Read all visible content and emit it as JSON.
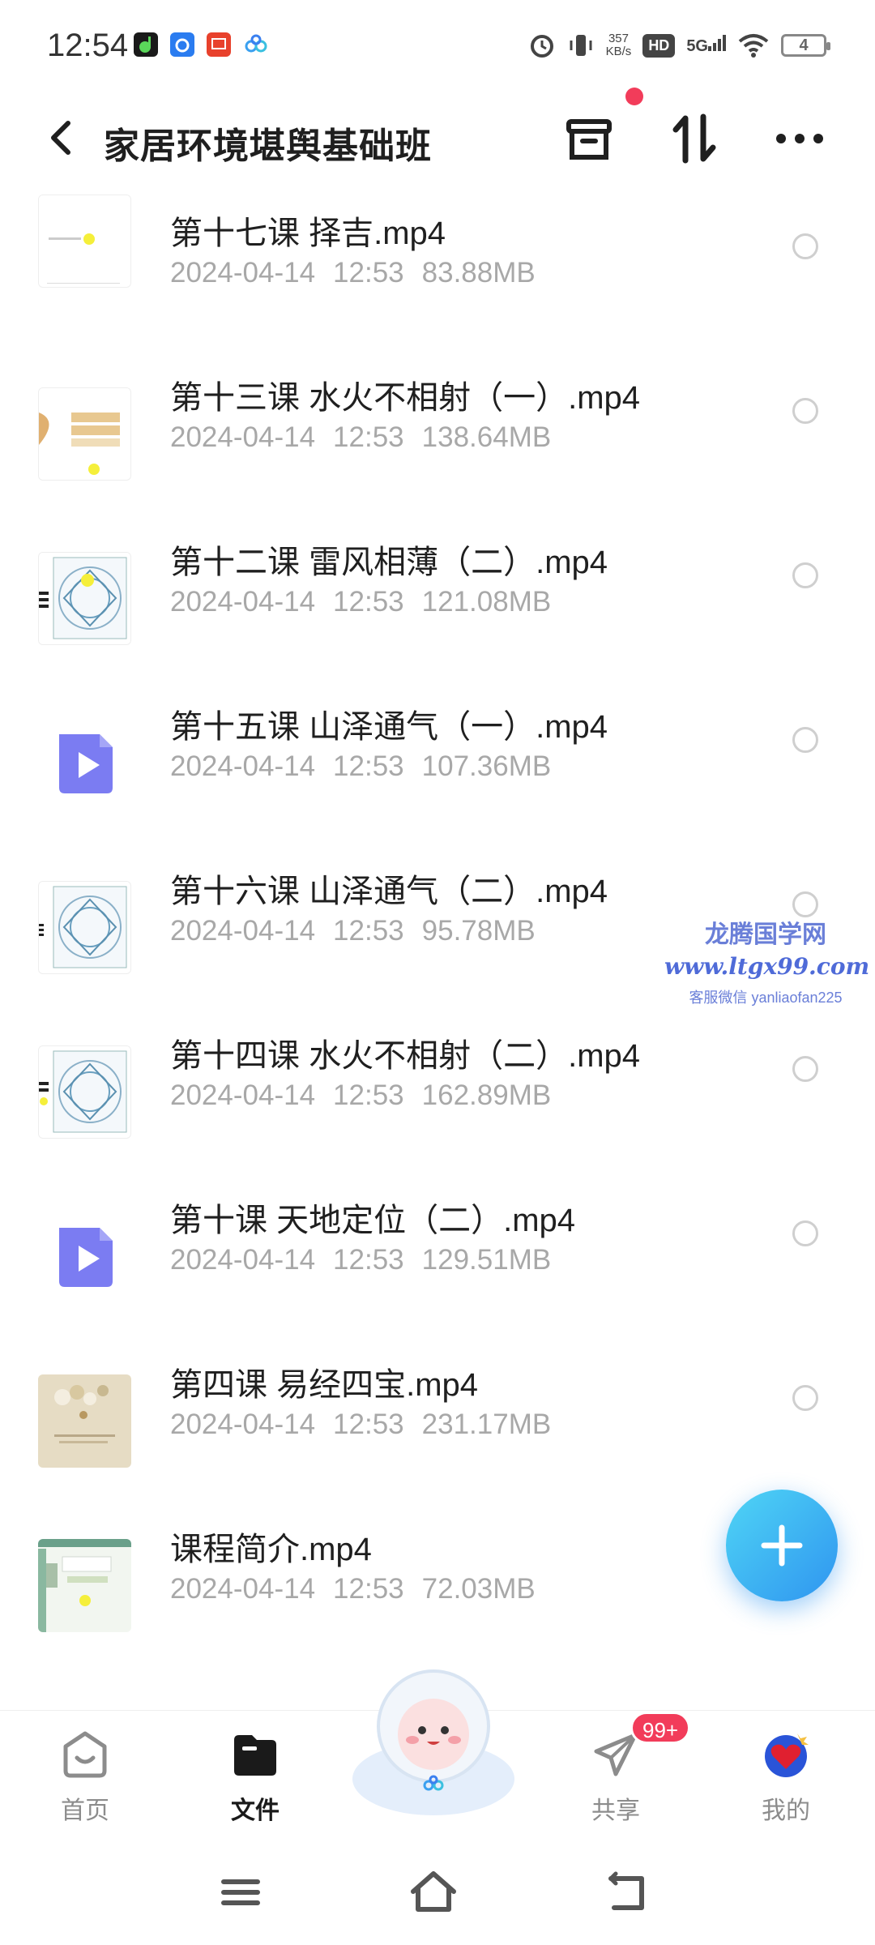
{
  "status_bar": {
    "time": "12:54",
    "net_speed_value": "357",
    "net_speed_unit": "KB/s",
    "hd": "HD",
    "signal": "5G",
    "battery": "4"
  },
  "header": {
    "title": "家居环境堪舆基础班"
  },
  "files": [
    {
      "name": "第十七课  择吉.mp4",
      "date": "2024-04-14",
      "time": "12:53",
      "size": "83.88MB",
      "thumb": "doc"
    },
    {
      "name": "第十三课 水火不相射（一）.mp4",
      "date": "2024-04-14",
      "time": "12:53",
      "size": "138.64MB",
      "thumb": "slide"
    },
    {
      "name": "第十二课 雷风相薄（二）.mp4",
      "date": "2024-04-14",
      "time": "12:53",
      "size": "121.08MB",
      "thumb": "diagram"
    },
    {
      "name": "第十五课 山泽通气（一）.mp4",
      "date": "2024-04-14",
      "time": "12:53",
      "size": "107.36MB",
      "thumb": "video"
    },
    {
      "name": "第十六课 山泽通气（二）.mp4",
      "date": "2024-04-14",
      "time": "12:53",
      "size": "95.78MB",
      "thumb": "diagram"
    },
    {
      "name": "第十四课 水火不相射（二）.mp4",
      "date": "2024-04-14",
      "time": "12:53",
      "size": "162.89MB",
      "thumb": "diagram"
    },
    {
      "name": "第十课 天地定位（二）.mp4",
      "date": "2024-04-14",
      "time": "12:53",
      "size": "129.51MB",
      "thumb": "video"
    },
    {
      "name": "第四课 易经四宝.mp4",
      "date": "2024-04-14",
      "time": "12:53",
      "size": "231.17MB",
      "thumb": "photo"
    },
    {
      "name": "课程简介.mp4",
      "date": "2024-04-14",
      "time": "12:53",
      "size": "72.03MB",
      "thumb": "intro"
    }
  ],
  "watermark": {
    "title": "龙腾国学网",
    "url": "www.ltgx99.com",
    "wechat": "客服微信 yanliaofan225"
  },
  "nav": {
    "home": "首页",
    "files": "文件",
    "share": "共享",
    "mine": "我的",
    "share_badge": "99+"
  },
  "colors": {
    "accent": "#2f95f0",
    "video_icon": "#7b7cf2",
    "badge": "#f23c5a"
  }
}
